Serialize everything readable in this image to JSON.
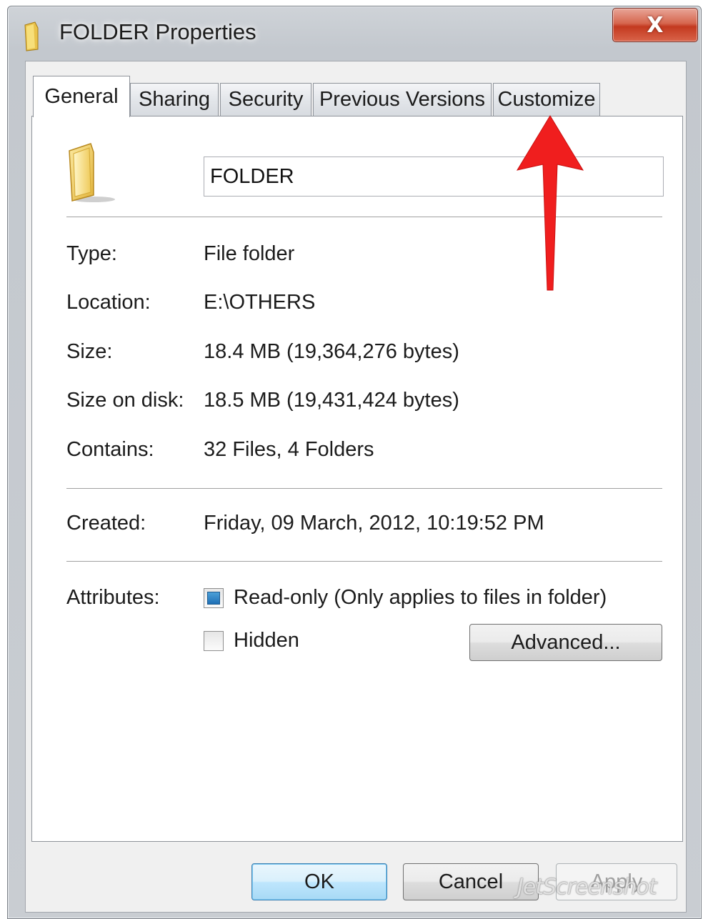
{
  "window": {
    "title": "FOLDER Properties",
    "close_label": "X"
  },
  "tabs": [
    {
      "label": "General",
      "active": true
    },
    {
      "label": "Sharing",
      "active": false
    },
    {
      "label": "Security",
      "active": false
    },
    {
      "label": "Previous Versions",
      "active": false
    },
    {
      "label": "Customize",
      "active": false
    }
  ],
  "general": {
    "folder_name": "FOLDER",
    "type": {
      "label": "Type:",
      "value": "File folder"
    },
    "location": {
      "label": "Location:",
      "value": "E:\\OTHERS"
    },
    "size": {
      "label": "Size:",
      "value": "18.4 MB (19,364,276 bytes)"
    },
    "size_on_disk": {
      "label": "Size on disk:",
      "value": "18.5 MB (19,431,424 bytes)"
    },
    "contains": {
      "label": "Contains:",
      "value": "32 Files, 4 Folders"
    },
    "created": {
      "label": "Created:",
      "value": "Friday, 09 March, 2012, 10:19:52 PM"
    },
    "attributes": {
      "label": "Attributes:",
      "readonly": {
        "label": "Read-only (Only applies to files in folder)",
        "checked": true
      },
      "hidden": {
        "label": "Hidden",
        "checked": false
      },
      "advanced_label": "Advanced..."
    }
  },
  "buttons": {
    "ok": "OK",
    "cancel": "Cancel",
    "apply": "Apply"
  },
  "annotation": {
    "color": "#f01e1e"
  },
  "watermark": "JetScreenshot"
}
